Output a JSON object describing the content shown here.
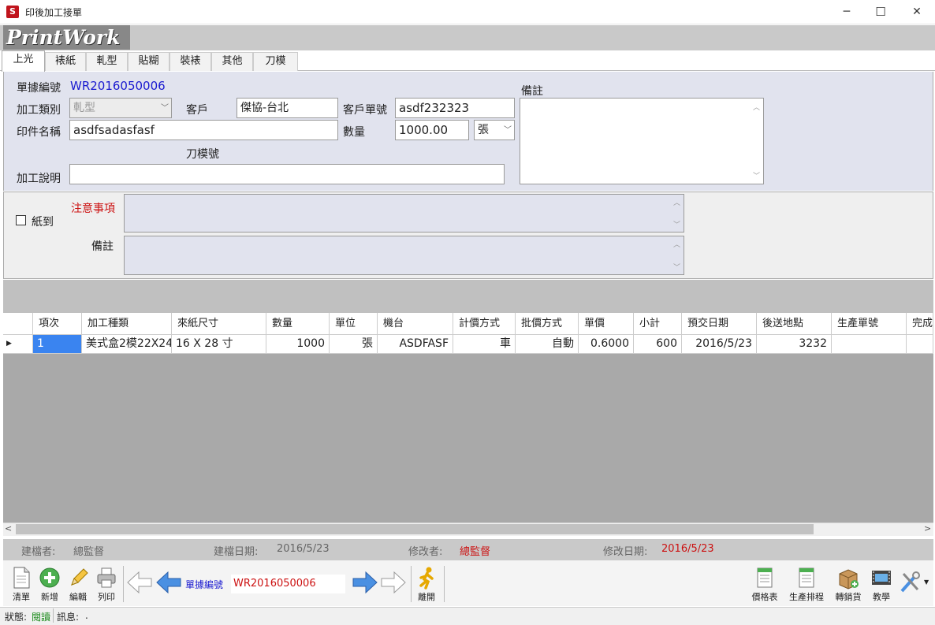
{
  "window": {
    "title": "印後加工接單",
    "icon_text": "S",
    "minimize": "─",
    "maximize": "☐",
    "close": "✕"
  },
  "logo": "PrintWork",
  "tabs": [
    "上光",
    "裱紙",
    "軋型",
    "貼糊",
    "裝裱",
    "其他",
    "刀模"
  ],
  "form": {
    "doc_no_label": "單據編號",
    "doc_no": "WR2016050006",
    "proc_type_label": "加工類別",
    "proc_type": "軋型",
    "customer_label": "客戶",
    "customer": "傑協-台北",
    "cust_order_label": "客戶單號",
    "cust_order": "asdf232323",
    "item_name_label": "印件名稱",
    "item_name": "asdfsadasfasf",
    "qty_label": "數量",
    "qty": "1000.00",
    "unit": "張",
    "die_no_label": "刀模號",
    "desc_label": "加工說明",
    "desc": "",
    "remark_label": "備註",
    "remark": ""
  },
  "notes": {
    "paper_arrived_label": "紙到",
    "paper_arrived": false,
    "attention_label": "注意事項",
    "attention": "",
    "remark_label": "備註",
    "remark": ""
  },
  "grid": {
    "columns": [
      "項次",
      "加工種類",
      "來紙尺寸",
      "數量",
      "單位",
      "機台",
      "計價方式",
      "批價方式",
      "單價",
      "小計",
      "預交日期",
      "後送地點",
      "生產單號",
      "完成"
    ],
    "rows": [
      {
        "item": "1",
        "type": "美式盒2模22X24",
        "size": "16 X 28 寸",
        "qty": "1000",
        "unit": "張",
        "machine": "ASDFASF",
        "pricing": "車",
        "batch_pricing": "自動",
        "unit_price": "0.6000",
        "subtotal": "600",
        "due_date": "2016/5/23",
        "ship_to": "3232",
        "prod_no": "",
        "done": ""
      }
    ]
  },
  "audit": {
    "creator_label": "建檔者:",
    "creator": "總監督",
    "created_label": "建檔日期:",
    "created": "2016/5/23",
    "modifier_label": "修改者:",
    "modifier": "總監督",
    "modified_label": "修改日期:",
    "modified": "2016/5/23"
  },
  "toolbar": {
    "list": "清單",
    "new": "新增",
    "edit": "編輯",
    "print": "列印",
    "doc_label": "單據編號",
    "doc_value": "WR2016050006",
    "exit": "離開",
    "price_table": "價格表",
    "schedule": "生產排程",
    "transfer": "轉銷貨",
    "teach": "教學"
  },
  "status": {
    "state_label": "狀態:",
    "state": "閱讀",
    "msg_label": "訊息:",
    "msg": "."
  },
  "colors": {
    "accent_blue": "#1a1ad0",
    "alert_red": "#cc1111",
    "status_green": "#1a8a1a",
    "panel_bg": "#e1e3ee"
  }
}
